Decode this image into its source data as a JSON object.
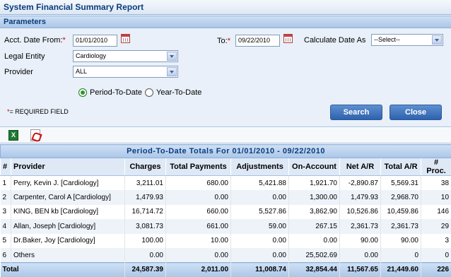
{
  "title": "System Financial Summary Report",
  "section_label": "Parameters",
  "form": {
    "acct_date_from_label": "Acct. Date From:",
    "required_mark": "*",
    "acct_date_from_value": "01/01/2010",
    "to_label": "To:",
    "to_value": "09/22/2010",
    "calc_date_as_label": "Calculate Date As",
    "calc_date_as_value": "--Select--",
    "legal_entity_label": "Legal Entity",
    "legal_entity_value": "Cardiology",
    "provider_label": "Provider",
    "provider_value": "ALL",
    "radio_period_label": "Period-To-Date",
    "radio_year_label": "Year-To-Date",
    "required_note": "= REQUIRED FIELD",
    "search_label": "Search",
    "close_label": "Close"
  },
  "export": {
    "excel_glyph": "X"
  },
  "table": {
    "caption": "Period-To-Date Totals For 01/01/2010 - 09/22/2010",
    "headers": [
      "#",
      "Provider",
      "Charges",
      "Total Payments",
      "Adjustments",
      "On-Account",
      "Net A/R",
      "Total A/R",
      "# Proc."
    ],
    "rows": [
      [
        "1",
        "Perry, Kevin J. [Cardiology]",
        "3,211.01",
        "680.00",
        "5,421.88",
        "1,921.70",
        "-2,890.87",
        "5,569.31",
        "38"
      ],
      [
        "2",
        "Carpenter, Carol A [Cardiology]",
        "1,479.93",
        "0.00",
        "0.00",
        "1,300.00",
        "1,479.93",
        "2,968.70",
        "10"
      ],
      [
        "3",
        "KING, BEN kb [Cardiology]",
        "16,714.72",
        "660.00",
        "5,527.86",
        "3,862.90",
        "10,526.86",
        "10,459.86",
        "146"
      ],
      [
        "4",
        "Allan, Joseph [Cardiology]",
        "3,081.73",
        "661.00",
        "59.00",
        "267.15",
        "2,361.73",
        "2,361.73",
        "29"
      ],
      [
        "5",
        "Dr.Baker, Joy [Cardiology]",
        "100.00",
        "10.00",
        "0.00",
        "0.00",
        "90.00",
        "90.00",
        "3"
      ],
      [
        "6",
        "Others",
        "0.00",
        "0.00",
        "0.00",
        "25,502.69",
        "0.00",
        "0",
        "0"
      ]
    ],
    "total": [
      "Total",
      "24,587.39",
      "2,011.00",
      "11,008.74",
      "32,854.44",
      "11,567.65",
      "21,449.60",
      "226"
    ]
  }
}
